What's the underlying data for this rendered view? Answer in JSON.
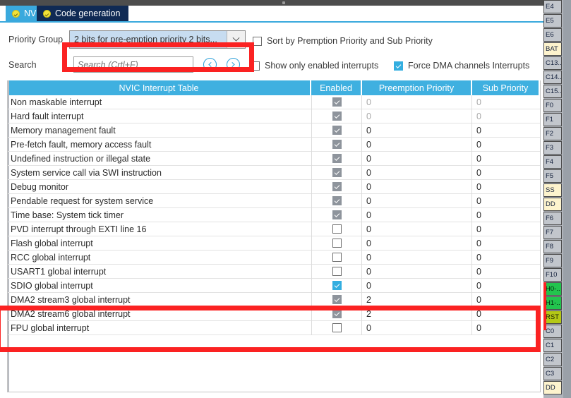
{
  "window": {
    "title_strip_color": "#4d4d4d"
  },
  "tabs": [
    {
      "label": "NVIC",
      "active": true
    },
    {
      "label": "Code generation",
      "active": false
    }
  ],
  "toolbar": {
    "priority_group_label": "Priority Group",
    "priority_group_value": "2 bits for pre-emption priority 2 bits...",
    "sort_checkbox_label": "Sort by Premption Priority and Sub Priority",
    "sort_checkbox_checked": false,
    "search_label": "Search",
    "search_value": "",
    "search_placeholder": "Search (Crtl+F)",
    "prev_icon": "chevron-left-circle-icon",
    "next_icon": "chevron-right-circle-icon",
    "show_only_enabled_label": "Show only enabled interrupts",
    "show_only_enabled_checked": false,
    "force_dma_label": "Force DMA channels Interrupts",
    "force_dma_checked": true
  },
  "table": {
    "headers": [
      "NVIC Interrupt Table",
      "Enabled",
      "Preemption Priority",
      "Sub Priority"
    ],
    "rows": [
      {
        "name": "Non maskable interrupt",
        "enabled": "checked-gray",
        "preemption": "0",
        "sub": "0",
        "dim": true
      },
      {
        "name": "Hard fault interrupt",
        "enabled": "checked-gray",
        "preemption": "0",
        "sub": "0",
        "dim": true
      },
      {
        "name": "Memory management fault",
        "enabled": "checked-gray",
        "preemption": "0",
        "sub": "0",
        "dim": false
      },
      {
        "name": "Pre-fetch fault, memory access fault",
        "enabled": "checked-gray",
        "preemption": "0",
        "sub": "0",
        "dim": false
      },
      {
        "name": "Undefined instruction or illegal state",
        "enabled": "checked-gray",
        "preemption": "0",
        "sub": "0",
        "dim": false
      },
      {
        "name": "System service call via SWI instruction",
        "enabled": "checked-gray",
        "preemption": "0",
        "sub": "0",
        "dim": false
      },
      {
        "name": "Debug monitor",
        "enabled": "checked-gray",
        "preemption": "0",
        "sub": "0",
        "dim": false
      },
      {
        "name": "Pendable request for system service",
        "enabled": "checked-gray",
        "preemption": "0",
        "sub": "0",
        "dim": false
      },
      {
        "name": "Time base: System tick timer",
        "enabled": "checked-gray",
        "preemption": "0",
        "sub": "0",
        "dim": false
      },
      {
        "name": "PVD interrupt through EXTI line 16",
        "enabled": "unchecked",
        "preemption": "0",
        "sub": "0",
        "dim": false
      },
      {
        "name": "Flash global interrupt",
        "enabled": "unchecked",
        "preemption": "0",
        "sub": "0",
        "dim": false
      },
      {
        "name": "RCC global interrupt",
        "enabled": "unchecked",
        "preemption": "0",
        "sub": "0",
        "dim": false
      },
      {
        "name": "USART1 global interrupt",
        "enabled": "unchecked",
        "preemption": "0",
        "sub": "0",
        "dim": false
      },
      {
        "name": "SDIO global interrupt",
        "enabled": "checked-blue",
        "preemption": "0",
        "sub": "0",
        "dim": false
      },
      {
        "name": "DMA2 stream3 global interrupt",
        "enabled": "checked-gray",
        "preemption": "2",
        "sub": "0",
        "dim": false
      },
      {
        "name": "DMA2 stream6 global interrupt",
        "enabled": "checked-gray",
        "preemption": "2",
        "sub": "0",
        "dim": false
      },
      {
        "name": "FPU global interrupt",
        "enabled": "unchecked",
        "preemption": "0",
        "sub": "0",
        "dim": false
      }
    ]
  },
  "annotations": {
    "highlight_color": "#fb2222",
    "boxes": [
      "priority-group-dropdown",
      "sdio-and-dma2-rows"
    ]
  },
  "pin_sidebar": {
    "pins": [
      {
        "label": "E4",
        "style": "plain"
      },
      {
        "label": "E5",
        "style": "plain"
      },
      {
        "label": "E6",
        "style": "plain"
      },
      {
        "label": "BAT",
        "style": "bat"
      },
      {
        "label": "C13..",
        "style": "plain"
      },
      {
        "label": "C14..",
        "style": "plain"
      },
      {
        "label": "C15..",
        "style": "plain"
      },
      {
        "label": "F0",
        "style": "plain"
      },
      {
        "label": "F1",
        "style": "plain"
      },
      {
        "label": "F2",
        "style": "plain"
      },
      {
        "label": "F3",
        "style": "plain"
      },
      {
        "label": "F4",
        "style": "plain"
      },
      {
        "label": "F5",
        "style": "plain"
      },
      {
        "label": "SS",
        "style": "bat"
      },
      {
        "label": "DD",
        "style": "bat"
      },
      {
        "label": "F6",
        "style": "plain"
      },
      {
        "label": "F7",
        "style": "plain"
      },
      {
        "label": "F8",
        "style": "plain"
      },
      {
        "label": "F9",
        "style": "plain"
      },
      {
        "label": "F10",
        "style": "plain"
      },
      {
        "label": "H0-..",
        "style": "green"
      },
      {
        "label": "H1-..",
        "style": "green"
      },
      {
        "label": "RST",
        "style": "olive"
      },
      {
        "label": "C0",
        "style": "plain"
      },
      {
        "label": "C1",
        "style": "plain"
      },
      {
        "label": "C2",
        "style": "plain"
      },
      {
        "label": "C3",
        "style": "plain"
      },
      {
        "label": "DD",
        "style": "bat"
      }
    ]
  }
}
